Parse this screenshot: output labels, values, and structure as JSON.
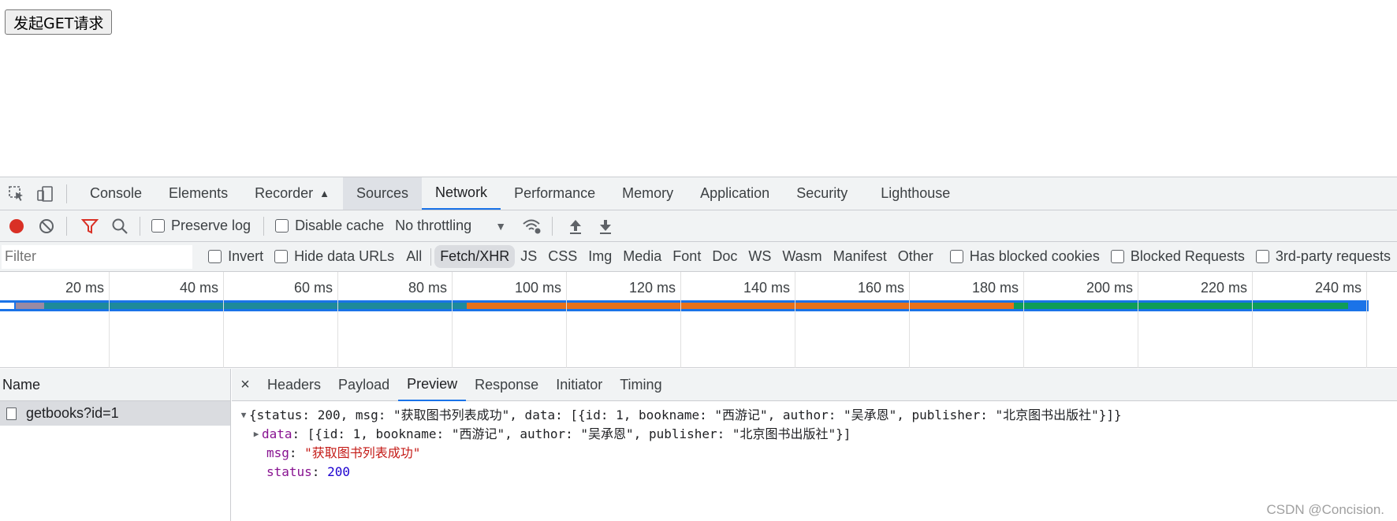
{
  "page": {
    "button_label": "发起GET请求"
  },
  "devtools": {
    "tabs": [
      "Console",
      "Elements",
      "Recorder",
      "Sources",
      "Network",
      "Performance",
      "Memory",
      "Application",
      "Security",
      "Lighthouse"
    ],
    "active_tab": "Network",
    "toolbar": {
      "preserve_log": "Preserve log",
      "disable_cache": "Disable cache",
      "throttling": "No throttling"
    },
    "filter": {
      "placeholder": "Filter",
      "invert": "Invert",
      "hide_data_urls": "Hide data URLs",
      "types": [
        "All",
        "Fetch/XHR",
        "JS",
        "CSS",
        "Img",
        "Media",
        "Font",
        "Doc",
        "WS",
        "Wasm",
        "Manifest",
        "Other"
      ],
      "selected_type": "Fetch/XHR",
      "has_blocked_cookies": "Has blocked cookies",
      "blocked_requests": "Blocked Requests",
      "third_party": "3rd-party requests"
    },
    "overview": {
      "ticks": [
        "20 ms",
        "40 ms",
        "60 ms",
        "80 ms",
        "100 ms",
        "120 ms",
        "140 ms",
        "160 ms",
        "180 ms",
        "200 ms",
        "220 ms",
        "240 ms"
      ],
      "colors": {
        "track": "#1a73e8",
        "waiting": "#e8711a",
        "download": "#0f9d58",
        "teal": "#1e8a9a"
      }
    },
    "requests": {
      "header": "Name",
      "items": [
        "getbooks?id=1"
      ]
    },
    "detail": {
      "close": "×",
      "tabs": [
        "Headers",
        "Payload",
        "Preview",
        "Response",
        "Initiator",
        "Timing"
      ],
      "active_tab": "Preview",
      "preview": {
        "summary": "{status: 200, msg: \"获取图书列表成功\", data: [{id: 1, bookname: \"西游记\", author: \"吴承恩\", publisher: \"北京图书出版社\"}]}",
        "data_key": "data",
        "data_value": "[{id: 1, bookname: \"西游记\", author: \"吴承恩\", publisher: \"北京图书出版社\"}]",
        "msg_key": "msg",
        "msg_value": "\"获取图书列表成功\"",
        "status_key": "status",
        "status_value": "200"
      }
    }
  },
  "watermark": "CSDN @Concision."
}
